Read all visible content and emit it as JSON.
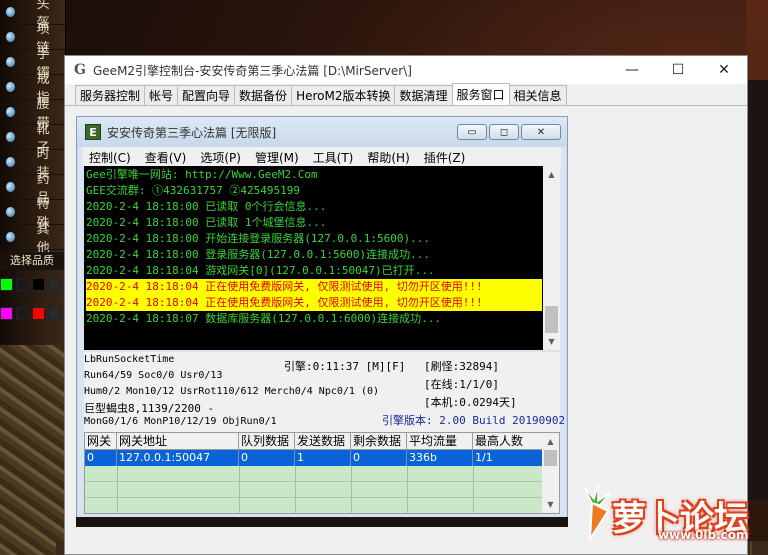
{
  "game": {
    "menu": [
      "头盔",
      "项链",
      "手镯",
      "戒指",
      "腰带",
      "靴子",
      "时装",
      "药品",
      "特殊",
      "其他"
    ],
    "select_label": "选择品质",
    "swatch_colors": [
      [
        "#00ff00",
        "#1a1a1a",
        "#000000",
        "#2a2a2a"
      ],
      [
        "#ff00ff",
        "#1a1a1a",
        "#ff0000",
        "#2a2a2a"
      ]
    ]
  },
  "logo": {
    "text": "萝卜论坛",
    "url": "www.0lb.com"
  },
  "main": {
    "title": "GeeM2引擎控制台-安安传奇第三季心法篇 [D:\\MirServer\\]",
    "app_icon": "G",
    "controls": [
      "—",
      "☐",
      "✕"
    ],
    "tabs": [
      "服务器控制",
      "帐号",
      "配置向导",
      "数据备份",
      "HeroM2版本转换",
      "数据清理",
      "服务窗口",
      "相关信息"
    ],
    "active_tab": 6
  },
  "inner": {
    "title": "安安传奇第三季心法篇 [无限版]",
    "icon": "E",
    "menu": [
      "控制(C)",
      "查看(V)",
      "选项(P)",
      "管理(M)",
      "工具(T)",
      "帮助(H)",
      "插件(Z)"
    ],
    "console": [
      {
        "text": "Gee引擎唯一网站: http://Www.GeeM2.Com",
        "warn": false
      },
      {
        "text": "GEE交流群: ①432631757   ②425495199",
        "warn": false
      },
      {
        "text": "2020-2-4 18:18:00 已读取 0个行会信息...",
        "warn": false
      },
      {
        "text": "2020-2-4 18:18:00 已读取 1个城堡信息...",
        "warn": false
      },
      {
        "text": "2020-2-4 18:18:00 开始连接登录服务器(127.0.0.1:5600)...",
        "warn": false
      },
      {
        "text": "2020-2-4 18:18:00 登录服务器(127.0.0.1:5600)连接成功...",
        "warn": false
      },
      {
        "text": "2020-2-4 18:18:04 游戏网关[0](127.0.0.1:50047)已打开...",
        "warn": false
      },
      {
        "text": "2020-2-4 18:18:04 正在使用免费版网关, 仅限测试使用, 切勿开区使用!!!",
        "warn": true
      },
      {
        "text": "2020-2-4 18:18:04 正在使用免费版网关, 仅限测试使用, 切勿开区使用!!!",
        "warn": true
      },
      {
        "text": "2020-2-4 18:18:07 数据库服务器(127.0.0.1:6000)连接成功...",
        "warn": false
      }
    ],
    "status": {
      "l1": "LbRunSocketTime",
      "l2": "Run64/59 Soc0/0 Usr0/13",
      "l3": "Hum0/2 Mon10/12 UsrRot110/612 Merch0/4 Npc0/1 (0)",
      "l4": "巨型蝎虫8,1139/2200 -",
      "l5": "MonG0/1/6 MonP10/12/19 ObjRun0/1",
      "engine": "引擎:0:11:37 [M][F]",
      "refresh": "[刷怪:32894]",
      "online": "[在线:1/1/0]",
      "local": "[本机:0.0294天]",
      "version": "引擎版本: 2.00 Build 20190902"
    },
    "grid": {
      "headers": [
        "网关",
        "网关地址",
        "队列数据",
        "发送数据",
        "剩余数据",
        "平均流量",
        "最高人数"
      ],
      "rows": [
        [
          "0",
          "127.0.0.1:50047",
          "0",
          "1",
          "0",
          "336b",
          "1/1"
        ]
      ]
    }
  }
}
